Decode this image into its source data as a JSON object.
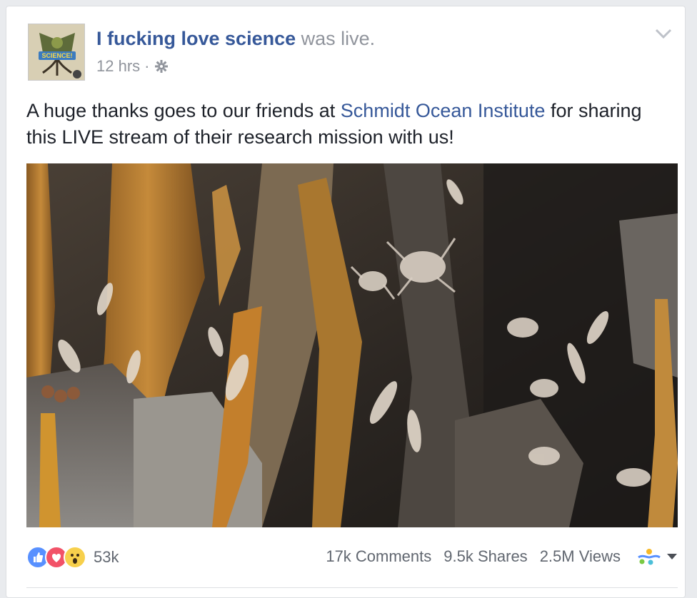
{
  "post": {
    "page_name": "I fucking love science",
    "action_text": " was live.",
    "time": "12 hrs",
    "separator": "·",
    "privacy_icon": "gear-icon",
    "menu_icon": "chevron-down-icon",
    "avatar_text": "SCIENCE!",
    "text_before_link": "A huge thanks goes to our friends at ",
    "link_text": "Schmidt Ocean Institute",
    "text_after_link": " for sharing this LIVE stream of their research mission with us!",
    "media_icon": "video-frame"
  },
  "footer": {
    "reaction_icons": [
      "like-icon",
      "love-icon",
      "wow-icon"
    ],
    "reaction_count": "53k",
    "comments": "17k Comments",
    "shares": "9.5k Shares",
    "views": "2.5M Views",
    "audience_icon": "audience-icon"
  },
  "colors": {
    "link": "#365899",
    "meta": "#90949c",
    "text": "#1d2129",
    "like": "#5890ff",
    "love": "#f25268",
    "wow": "#f7d04c"
  }
}
